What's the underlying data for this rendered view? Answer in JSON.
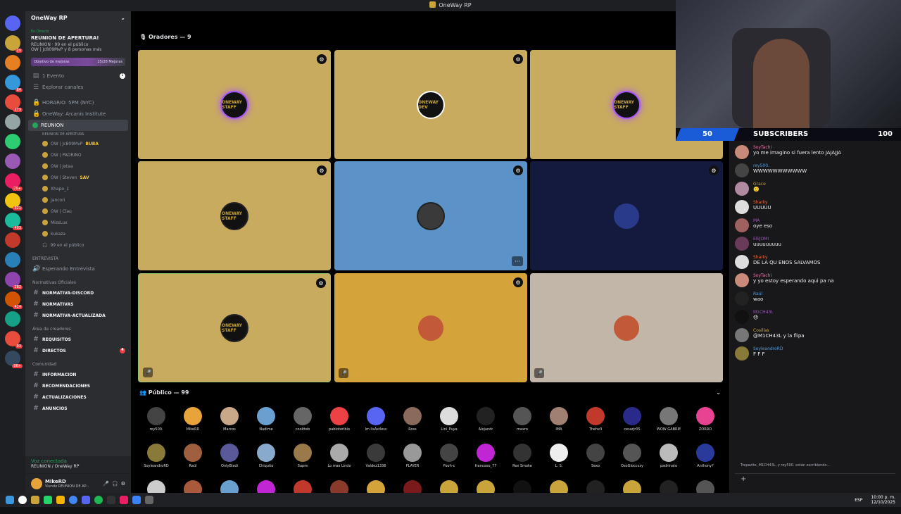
{
  "window_title": "OneWay RP",
  "sidebar": {
    "server_name": "OneWay RP",
    "live_label": "En Directo",
    "stage_title": "REUNION DE APERTURA!",
    "stage_sub1": "REUNION · 99 en el público",
    "stage_sub2": "OW | Jc809MvP y 8 personas más",
    "goal_label": "Objetivo de mejoras",
    "goal_value": "25/28 Mejoras",
    "events": "1 Evento",
    "events_count": "1",
    "explore": "Explorar canales",
    "schedule": "HORARIO: 5PM (NYC)",
    "arcanis": "OneWay: Arcanis Institute",
    "reunion": "REUNION",
    "reunion_sub": "REUNION DE APERTURA",
    "members": [
      "OW | Jc809MvP",
      "OW | PADRINO",
      "OW | Jotaa",
      "OW | Steven",
      "Xhapo_1",
      "Jancori",
      "OW | Clau",
      "MissLux",
      "kukaza"
    ],
    "member_tags": [
      "BUBA",
      "",
      "",
      "SAV",
      "",
      "",
      "",
      "",
      ""
    ],
    "audience_count": "99 en el público",
    "cat_entrevista": "ENTREVISTA",
    "esperando": "Esperando Entrevista",
    "cat_normativas": "Normativas Oficiales",
    "normativa1": "NORMATIVA-DISCORD",
    "normativa2": "NORMATIVAS",
    "normativa3": "NORMATIVA-ACTUALIZADA",
    "cat_creadores": "Área de creadores",
    "requisitos": "REQUISITOS",
    "directos": "DIRECTOS",
    "directos_count": "4",
    "cat_comunidad": "Comunidad",
    "informacion": "INFORMACION",
    "recomendaciones": "RECOMENDACIONES",
    "actualizaciones": "ACTUALIZACIONES",
    "anuncios": "ANUNCIOS",
    "voice_status": "Voz conectada",
    "voice_sub": "REUNION / OneWay RP",
    "username": "MikeRD",
    "user_status": "Viendo REUNION DE AP..."
  },
  "servers": [
    {
      "color": "#5865f2",
      "count": ""
    },
    {
      "color": "#c9a43a",
      "count": "29"
    },
    {
      "color": "#e67e22",
      "count": ""
    },
    {
      "color": "#3498db",
      "count": "64"
    },
    {
      "color": "#e74c3c",
      "count": "279"
    },
    {
      "color": "#95a5a6",
      "count": ""
    },
    {
      "color": "#2ecc71",
      "count": ""
    },
    {
      "color": "#9b59b6",
      "count": ""
    },
    {
      "color": "#e91e63",
      "count": "7K+"
    },
    {
      "color": "#f1c40f",
      "count": "321"
    },
    {
      "color": "#1abc9c",
      "count": "403"
    },
    {
      "color": "#c0392b",
      "count": ""
    },
    {
      "color": "#2980b9",
      "count": ""
    },
    {
      "color": "#8e44ad",
      "count": "282"
    },
    {
      "color": "#d35400",
      "count": "414"
    },
    {
      "color": "#16a085",
      "count": ""
    },
    {
      "color": "#e74c3c",
      "count": "93"
    },
    {
      "color": "#34495e",
      "count": "9K+"
    }
  ],
  "stage": {
    "speakers_label": "Oradores — 9",
    "audience_label": "Público — 99",
    "tiles": [
      {
        "bg": "#c9ab60",
        "ring": "#a855f7",
        "text": "ONEWAY STAFF",
        "mod": true,
        "mute": false,
        "more": false
      },
      {
        "bg": "#c9ab60",
        "ring": "#ffffff",
        "text": "ONEWAY DEV",
        "mod": true,
        "mute": false,
        "more": false
      },
      {
        "bg": "#c9ab60",
        "ring": "#a855f7",
        "text": "ONEWAY STAFF",
        "mod": false,
        "mute": false,
        "more": false
      },
      {
        "bg": "#c9ab60",
        "ring": "#222222",
        "text": "ONEWAY STAFF",
        "mod": true,
        "mute": false,
        "more": false
      },
      {
        "bg": "#5b93c8",
        "ring": "#222222",
        "text": "",
        "mod": true,
        "mute": false,
        "more": true
      },
      {
        "bg": "#141a3e",
        "ring": "#141a3e",
        "text": "",
        "mod": true,
        "mute": false,
        "more": false
      },
      {
        "bg": "#c9ab60",
        "ring": "#222222",
        "text": "ONEWAY STAFF",
        "mod": true,
        "mute": true,
        "more": false
      },
      {
        "bg": "#d4a33a",
        "ring": "#d4a33a",
        "text": "",
        "mod": true,
        "mute": true,
        "more": false
      },
      {
        "bg": "#c2b6a8",
        "ring": "#c2b6a8",
        "text": "",
        "mod": false,
        "mute": true,
        "more": false
      }
    ],
    "audience": [
      {
        "name": "rey500.",
        "color": "#444"
      },
      {
        "name": "MikeRD",
        "color": "#e8a33a"
      },
      {
        "name": "Marcos",
        "color": "#c9a88a"
      },
      {
        "name": "Nadime",
        "color": "#6aa0d0"
      },
      {
        "name": "cooltteb",
        "color": "#666"
      },
      {
        "name": "pablotoribio",
        "color": "#ed4245"
      },
      {
        "name": "Im lisAstless",
        "color": "#5865f2"
      },
      {
        "name": "Ross",
        "color": "#8a6a5a"
      },
      {
        "name": "Lini_Puya",
        "color": "#ddd"
      },
      {
        "name": "Alejandr",
        "color": "#222"
      },
      {
        "name": "maxro",
        "color": "#555"
      },
      {
        "name": "IMA",
        "color": "#a08070"
      },
      {
        "name": "Thehx3",
        "color": "#c0392b"
      },
      {
        "name": "cesarjr05",
        "color": "#2a2a8a"
      },
      {
        "name": "WOW GABRIE",
        "color": "#777"
      },
      {
        "name": "ZORRO",
        "color": "#e84393"
      },
      {
        "name": "SoyleandroRD",
        "color": "#8a7a3a"
      },
      {
        "name": "Raúl",
        "color": "#a06040"
      },
      {
        "name": "OnlyBladi",
        "color": "#5a5a9a"
      },
      {
        "name": "Chiquito",
        "color": "#88aacc"
      },
      {
        "name": "Supre",
        "color": "#9a7a4a"
      },
      {
        "name": "Lo mas Lindo",
        "color": "#aaa"
      },
      {
        "name": "Valdez1336",
        "color": "#3a3a3a"
      },
      {
        "name": "PLAYER",
        "color": "#999"
      },
      {
        "name": "Pooh-c",
        "color": "#444"
      },
      {
        "name": "francooo_77",
        "color": "#c026d3"
      },
      {
        "name": "Rex Smoke",
        "color": "#333"
      },
      {
        "name": "L. S.",
        "color": "#eee"
      },
      {
        "name": "Sexo",
        "color": "#444"
      },
      {
        "name": "OsoGloccxzy",
        "color": "#555"
      },
      {
        "name": "padrinato",
        "color": "#bbb"
      },
      {
        "name": "Anthony?",
        "color": "#2a3a9a"
      },
      {
        "name": "",
        "color": "#ccc"
      },
      {
        "name": "",
        "color": "#aa5a3a"
      },
      {
        "name": "",
        "color": "#6aa0d0"
      },
      {
        "name": "",
        "color": "#c026d3"
      },
      {
        "name": "",
        "color": "#c0392b"
      },
      {
        "name": "",
        "color": "#8a3a2a"
      },
      {
        "name": "",
        "color": "#d4a33a"
      },
      {
        "name": "",
        "color": "#7a1a1a"
      },
      {
        "name": "",
        "color": "#c9a43a"
      },
      {
        "name": "",
        "color": "#c9a43a"
      },
      {
        "name": "",
        "color": "#111"
      },
      {
        "name": "",
        "color": "#c9a43a"
      },
      {
        "name": "",
        "color": "#222"
      },
      {
        "name": "",
        "color": "#c9a43a"
      },
      {
        "name": "",
        "color": "#222"
      },
      {
        "name": "",
        "color": "#555"
      }
    ]
  },
  "subs": {
    "left": "50",
    "label": "SUBSCRIBERS",
    "right": "100"
  },
  "chat": {
    "messages": [
      {
        "name": "SoyTachi",
        "text": "yo me imagino  si fuera lento JAJAJJA",
        "color": "#e879a8",
        "av": "#c98a7a"
      },
      {
        "name": "rey500.",
        "text": "WWWWWWWWWWW",
        "color": "#5b9bd5",
        "av": "#444"
      },
      {
        "name": "Grace",
        "text": "🙂",
        "color": "#c9a43a",
        "av": "#b08aa0"
      },
      {
        "name": "Sharky",
        "text": "UUUUU",
        "color": "#e86a3a",
        "av": "#ddd"
      },
      {
        "name": "MA",
        "text": "oye eso",
        "color": "#9b59b6",
        "av": "#a06060"
      },
      {
        "name": "ElliJOMI",
        "text": "uuuuuuuuu",
        "color": "#9b59b6",
        "av": "#6a3a5a"
      },
      {
        "name": "Sharky",
        "text": "DE LA QU ENOS SALVAMOS",
        "color": "#e86a3a",
        "av": "#ddd"
      },
      {
        "name": "SoyTachi",
        "text": "y yo estoy esperando aqui pa na",
        "color": "#e879a8",
        "av": "#c98a7a"
      },
      {
        "name": "Raúl",
        "text": "wao",
        "color": "#5b9bd5",
        "av": "#222"
      },
      {
        "name": "M1CH43L",
        "text": "😞",
        "color": "#9b59b6",
        "av": "#111"
      },
      {
        "name": "Cosillas",
        "text": "@M1CH43L y la flipa",
        "color": "#c9a43a",
        "av": "#777"
      },
      {
        "name": "SoyleandroRD",
        "text": "F F F",
        "color": "#5b9bd5",
        "av": "#8a7a3a"
      }
    ],
    "typing": "Trepazito, M1CH43L, y rey500. están escribiendo..."
  },
  "taskbar": {
    "time": "10:00 p. m.",
    "date": "12/10/2025",
    "lang": "ESP"
  }
}
